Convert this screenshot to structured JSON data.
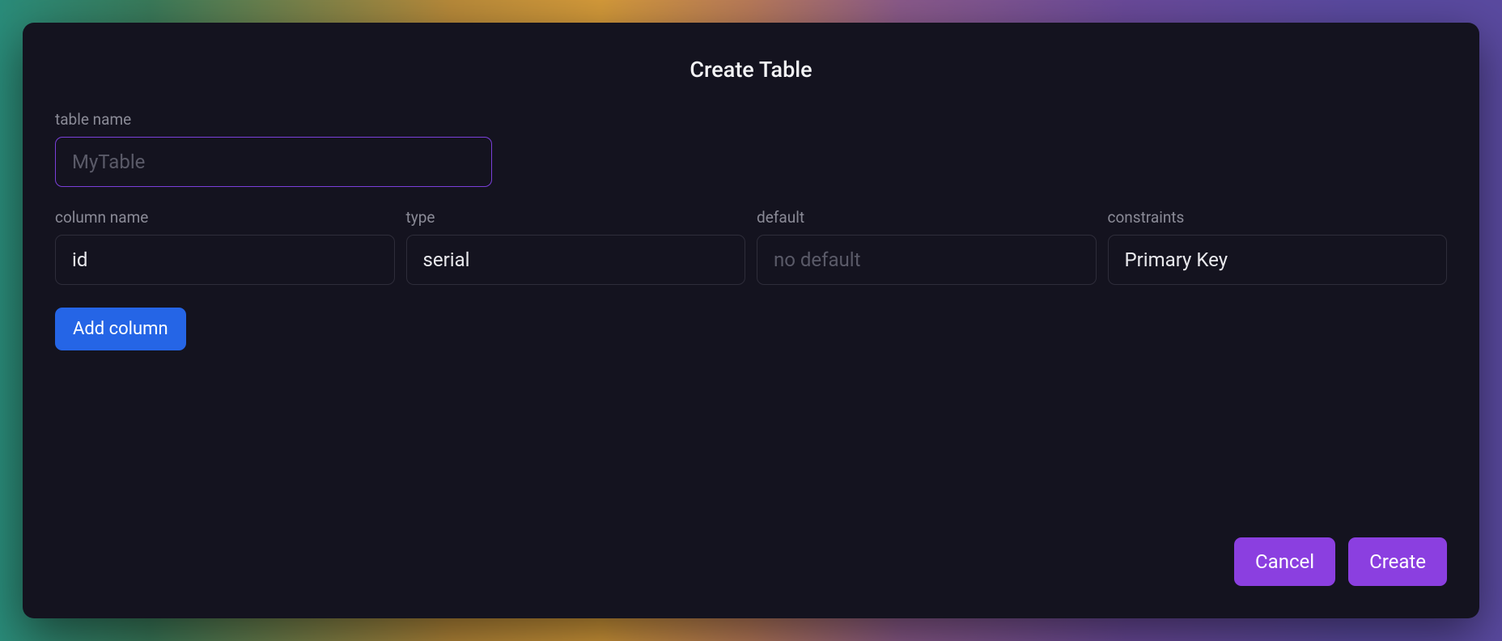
{
  "modal": {
    "title": "Create Table"
  },
  "table_name": {
    "label": "table name",
    "placeholder": "MyTable",
    "value": ""
  },
  "columns_header": {
    "name_label": "column name",
    "type_label": "type",
    "default_label": "default",
    "constraints_label": "constraints"
  },
  "columns": [
    {
      "name": "id",
      "type": "serial",
      "default": "",
      "default_placeholder": "no default",
      "constraints": "Primary Key"
    }
  ],
  "buttons": {
    "add_column": "Add column",
    "cancel": "Cancel",
    "create": "Create"
  },
  "colors": {
    "accent_purple": "#8b3fe0",
    "accent_blue": "#2565e6",
    "focus_border": "#7a3fd9",
    "bg_modal": "#14131f"
  }
}
